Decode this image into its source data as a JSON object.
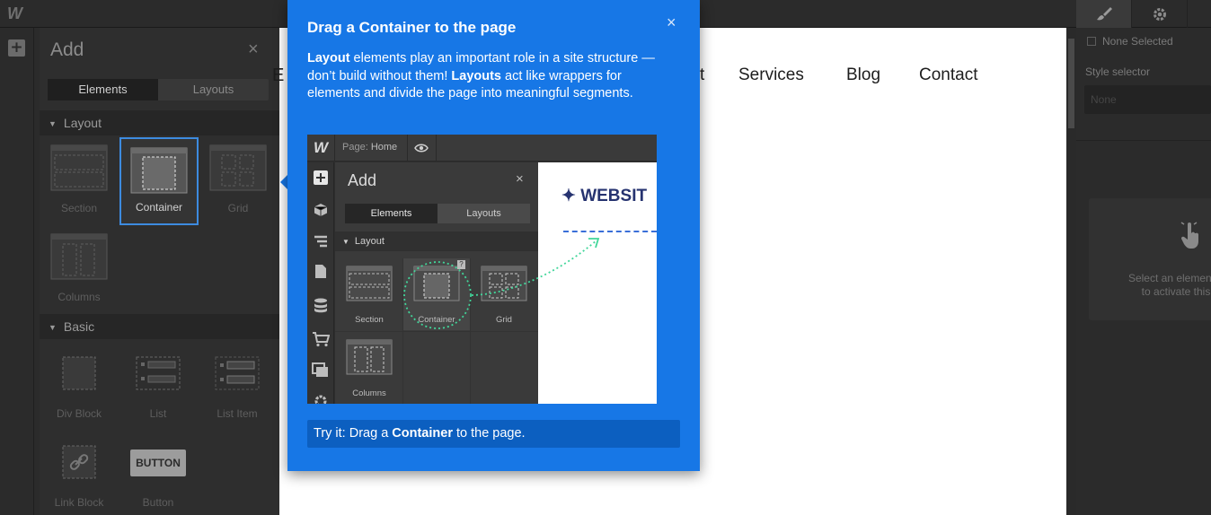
{
  "app": {
    "logo": "W"
  },
  "add_panel": {
    "title": "Add",
    "close": "×",
    "tabs": [
      {
        "label": "Elements",
        "active": true
      },
      {
        "label": "Layouts",
        "active": false
      }
    ],
    "sections": [
      {
        "title": "Layout",
        "items": [
          "Section",
          "Container",
          "Grid",
          "Columns"
        ],
        "selected": "Container"
      },
      {
        "title": "Basic",
        "items": [
          "Div Block",
          "List",
          "List Item",
          "Link Block",
          "Button"
        ]
      }
    ],
    "button_tile_text": "BUTTON"
  },
  "canvas": {
    "nav": [
      "Services",
      "Blog",
      "Contact"
    ],
    "partial_left": "E",
    "partial_mid": "t"
  },
  "right_panel": {
    "none_selected": "None Selected",
    "style_selector": "Style selector",
    "style_placeholder": "None",
    "hint": "Select an element o\nto activate this"
  },
  "popover": {
    "title": "Drag a Container to the page",
    "close": "×",
    "body_parts": {
      "b1": "Layout",
      "t1": " elements play an important role in a site structure — don’t build without them! ",
      "b2": "Layouts",
      "t2": " act like wrappers for elements and divide the page into meaningful segments."
    },
    "try_parts": {
      "t1": "Try it: Drag a ",
      "b1": "Container",
      "t2": " to the page."
    }
  },
  "illustration": {
    "logo": "W",
    "page_label": "Page:",
    "page_name": "Home",
    "add_title": "Add",
    "close": "×",
    "tabs": [
      "Elements",
      "Layouts"
    ],
    "section": "Layout",
    "items": [
      "Section",
      "Container",
      "Grid",
      "Columns"
    ],
    "badge": "?",
    "site_title": "✦ WEBSIT"
  },
  "colors": {
    "accent": "#1777e6",
    "try_bg": "#0c5fc0",
    "selection": "#3d8be0",
    "dark_bg": "#2b2b2b"
  }
}
